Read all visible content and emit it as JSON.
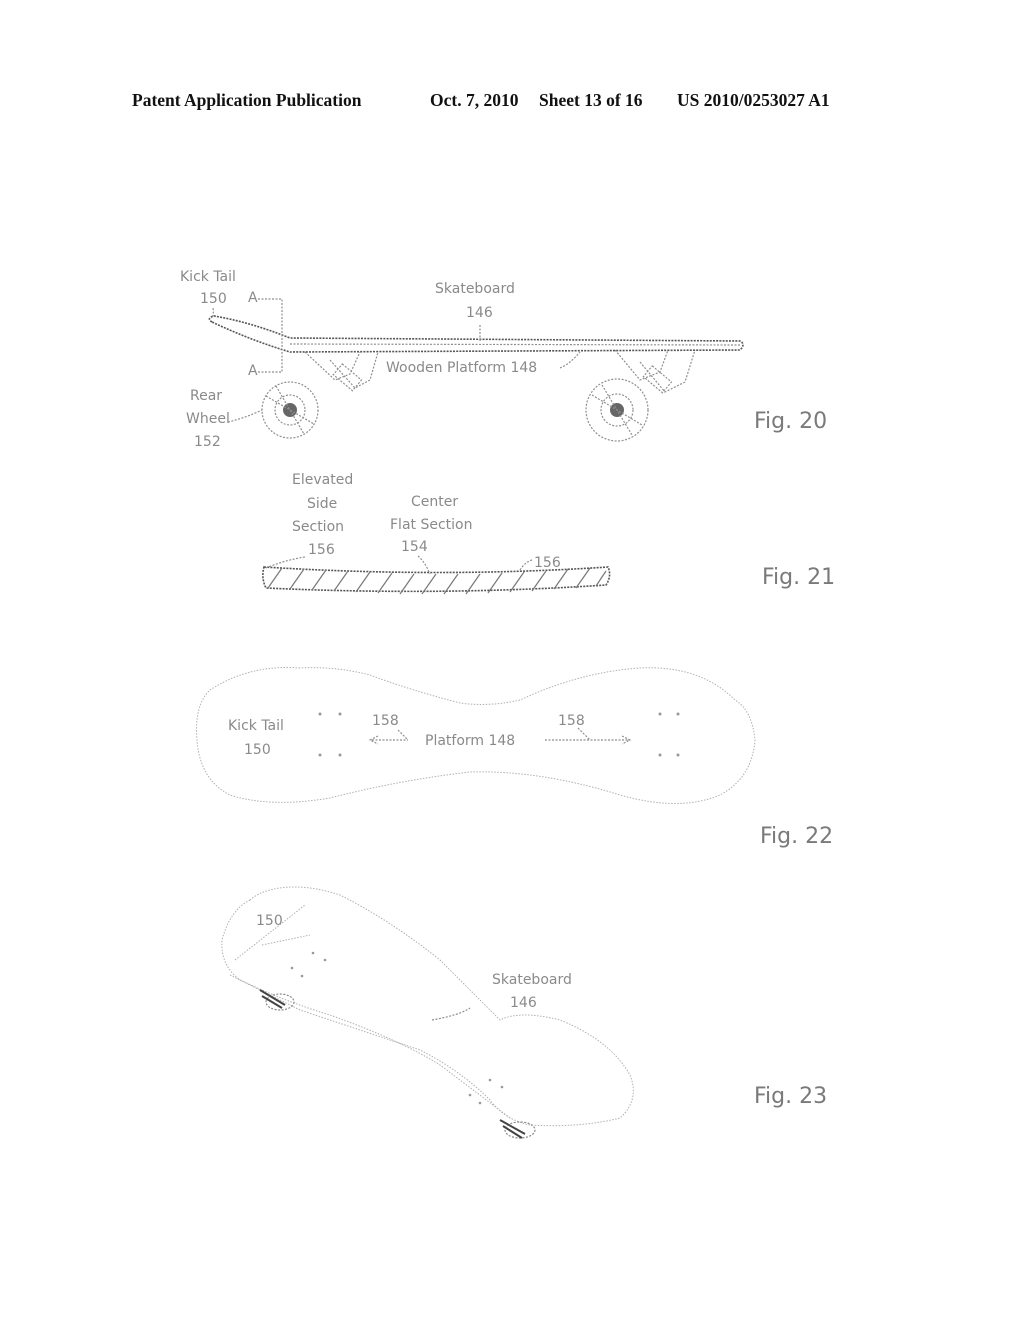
{
  "header": {
    "publication_type": "Patent Application Publication",
    "date": "Oct. 7, 2010",
    "sheet": "Sheet 13 of 16",
    "publication_number": "US 2010/0253027 A1"
  },
  "figures": [
    {
      "id": "fig20",
      "caption": "Fig. 20",
      "labels": {
        "kick_tail": "Kick Tail",
        "kick_tail_ref": "150",
        "skateboard": "Skateboard",
        "skateboard_ref": "146",
        "wooden_platform": "Wooden Platform 148",
        "rear_wheel_1": "Rear",
        "rear_wheel_2": "Wheel",
        "rear_wheel_ref": "152",
        "section_marker": "A"
      }
    },
    {
      "id": "fig21",
      "caption": "Fig. 21",
      "labels": {
        "elevated_1": "Elevated",
        "elevated_2": "Side",
        "elevated_3": "Section",
        "elevated_ref": "156",
        "center_1": "Center",
        "center_2": "Flat Section",
        "center_ref": "154",
        "right_ref": "156"
      }
    },
    {
      "id": "fig22",
      "caption": "Fig. 22",
      "labels": {
        "kick_tail": "Kick Tail",
        "kick_tail_ref": "150",
        "ref_left": "158",
        "platform": "Platform 148",
        "ref_right": "158"
      }
    },
    {
      "id": "fig23",
      "caption": "Fig. 23",
      "labels": {
        "tail_ref": "150",
        "skateboard": "Skateboard",
        "skateboard_ref": "146"
      }
    }
  ]
}
